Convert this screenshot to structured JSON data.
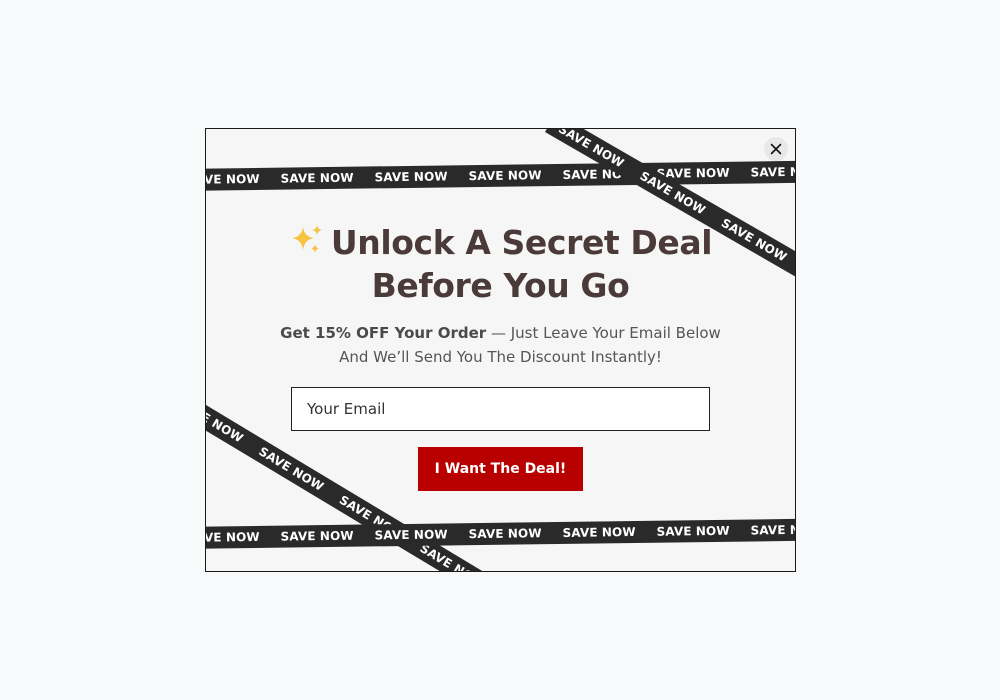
{
  "popup": {
    "close_icon": "close-icon",
    "ribbon_text": "SAVE NOW",
    "headline_icon": "sparkles-icon",
    "headline": "Unlock A Secret Deal Before You Go",
    "subtext_bold": "Get 15% OFF Your Order",
    "subtext_rest": " — Just Leave Your Email Below And We’ll Send You The Discount Instantly!",
    "email_placeholder": "Your Email",
    "email_value": "",
    "cta_label": "I Want The Deal!"
  },
  "colors": {
    "background": "#f8f9fb",
    "popup_background": "#f6f6f6",
    "ribbon": "#2a2a2a",
    "headline": "#4a3a3a",
    "cta": "#b80000"
  }
}
